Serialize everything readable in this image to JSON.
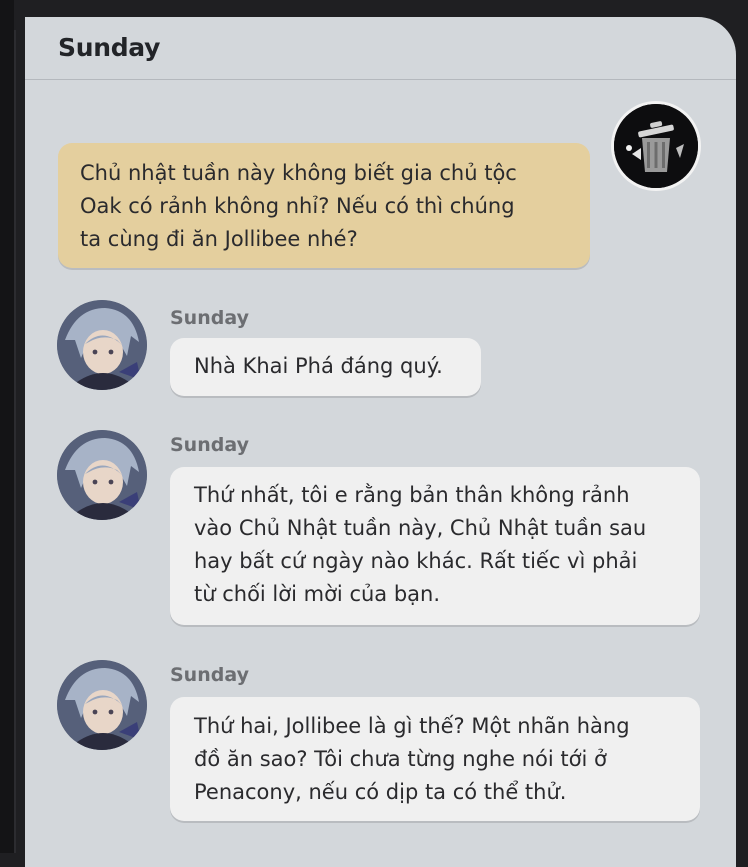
{
  "header": {
    "title": "Sunday"
  },
  "messages": [
    {
      "from": "player",
      "avatar_icon": "trash-can-avatar-icon",
      "lines": [
        "Chủ nhật tuần này không biết gia chủ tộc",
        "Oak có rảnh không nhỉ? Nếu có thì chúng",
        "ta cùng đi ăn Jollibee nhé?"
      ]
    },
    {
      "from": "npc",
      "sender": "Sunday",
      "avatar_icon": "sunday-portrait-avatar",
      "lines": [
        "Nhà Khai Phá đáng quý."
      ]
    },
    {
      "from": "npc",
      "sender": "Sunday",
      "avatar_icon": "sunday-portrait-avatar",
      "lines": [
        "Thứ nhất, tôi e rằng bản thân không rảnh",
        "vào Chủ Nhật tuần này, Chủ Nhật tuần sau",
        "hay bất cứ ngày nào khác. Rất tiếc vì phải",
        "từ chối lời mời của bạn."
      ]
    },
    {
      "from": "npc",
      "sender": "Sunday",
      "avatar_icon": "sunday-portrait-avatar",
      "lines": [
        "Thứ hai, Jollibee là gì thế? Một nhãn hàng",
        "đồ ăn sao? Tôi chưa từng nghe nói tới ở",
        "Penacony, nếu có dịp ta có thể thử."
      ]
    }
  ],
  "colors": {
    "window_bg": "#d3d7db",
    "player_bubble": "#e4cf9e",
    "npc_bubble": "#f0f0f0",
    "outer_bg": "#1f1f22"
  }
}
